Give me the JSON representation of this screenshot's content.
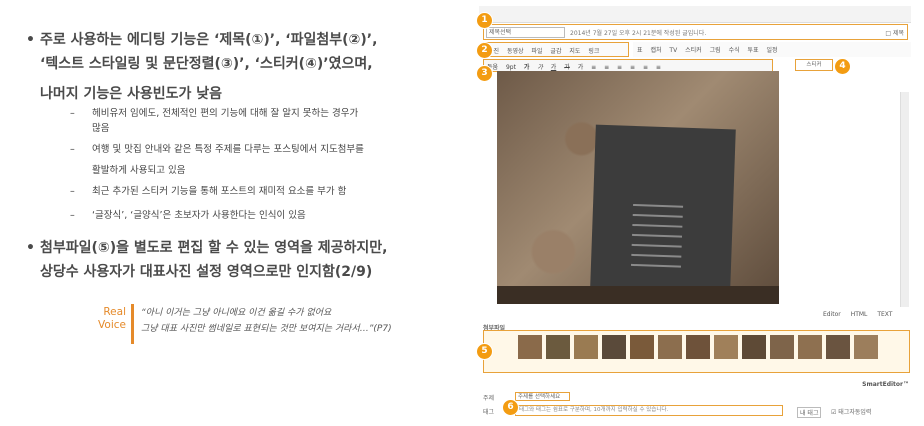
{
  "bullets": {
    "b1_line1": "주로 사용하는 에디팅 기능은 ‘제목(①)’, ‘파일첨부(②)’,",
    "b1_line2": "‘텍스트 스타일링 및 문단정렬(③)’, ‘스티커(④)’였으며,",
    "b1_line3": "나머지 기능은 사용빈도가 낮음",
    "subs": [
      "헤비유저 임에도, 전체적인 편의 기능에 대해 잘 알지 못하는 경우가",
      "많음",
      "여행 및 맛집 안내와 같은 특정 주제를 다루는 포스팅에서 지도첨부를",
      "활발하게 사용되고 있음",
      "최근 추가된 스티커 기능을 통해 포스트의 재미적 요소를 부가 함",
      "‘글장식’, ‘글양식’은 초보자가 사용한다는 인식이 있음"
    ],
    "b2_line1": "첨부파일(⑤)을 별도로 편집 할 수 있는 영역을 제공하지만,",
    "b2_line2": "상당수 사용자가 대표사진 설정 영역으로만 인지함(2/9)"
  },
  "voice": {
    "label1": "Real",
    "label2": "Voice",
    "quote1": "“아니 이거는 그냥 아니에요 이건 옮길 수가 없어요",
    "quote2": "그냥 대표 사진만 썸네일로 표현되는 것만 보여지는 거라서…”(P7)"
  },
  "editor": {
    "badges": [
      "1",
      "2",
      "3",
      "4",
      "5",
      "6"
    ],
    "title_select": "제목선택",
    "title_text": "2014년 7월 27일 오후 2시 21분에 작성된 글입니다.",
    "title_check": "□ 제목",
    "insert_items": [
      "사진",
      "동영상",
      "파일",
      "글감",
      "지도",
      "링크"
    ],
    "insert_items2": [
      "표",
      "캡처",
      "TV",
      "스티커",
      "그림",
      "수식",
      "투표",
      "일정"
    ],
    "format_items": [
      "돋움",
      "9pt",
      "가",
      "가",
      "가",
      "가",
      "가",
      "≡",
      "≡",
      "≡",
      "≡",
      "≡",
      "≡"
    ],
    "sticker_label": "스티커",
    "tabs": [
      "Editor",
      "HTML",
      "TEXT"
    ],
    "attach_label": "첨부파일",
    "smart_editor": "SmartEditor™",
    "topic_label": "주제",
    "topic_value": "주제를 선택하세요",
    "tag_label": "태그",
    "tag_placeholder": "태그와 태그는 쉼표로 구분하며, 10개까지 입력하실 수 있습니다.",
    "tag_btn": "내 태그",
    "tag_check": "☑ 태그자동입력"
  }
}
